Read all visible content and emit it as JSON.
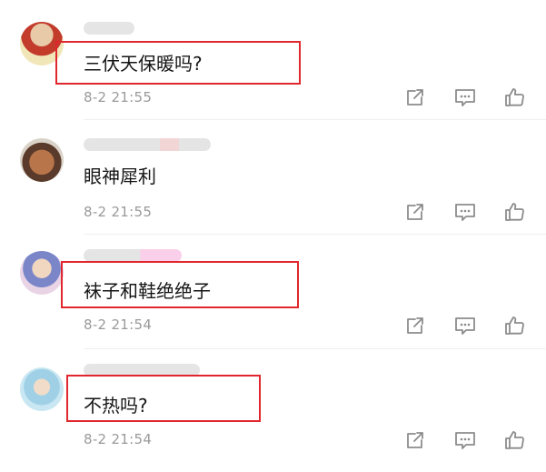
{
  "comments": [
    {
      "text": "三伏天保暖吗?",
      "time": "8-2 21:55",
      "highlighted": true
    },
    {
      "text": "眼神犀利",
      "time": "8-2 21:55",
      "highlighted": false
    },
    {
      "text": "袜子和鞋绝绝子",
      "time": "8-2 21:54",
      "highlighted": true
    },
    {
      "text": "不热吗?",
      "time": "8-2 21:54",
      "highlighted": true
    }
  ],
  "icons": {
    "share": "share-icon",
    "reply": "comment-icon",
    "like": "thumbs-up-icon"
  },
  "colors": {
    "highlight_border": "#e0272e",
    "timestamp": "#9a9a9a",
    "icon": "#8c8c8c"
  }
}
